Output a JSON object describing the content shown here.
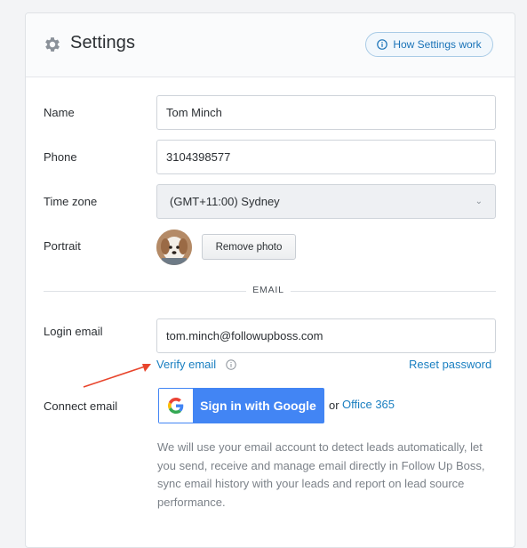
{
  "header": {
    "title": "Settings",
    "help_button_label": "How Settings work",
    "gear_icon": "gear-icon",
    "info_icon": "info-icon"
  },
  "form": {
    "name": {
      "label": "Name",
      "value": "Tom Minch"
    },
    "phone": {
      "label": "Phone",
      "value": "3104398577"
    },
    "timezone": {
      "label": "Time zone",
      "value": "(GMT+11:00) Sydney"
    },
    "portrait": {
      "label": "Portrait",
      "remove_label": "Remove photo"
    }
  },
  "email_section": {
    "divider_label": "EMAIL",
    "login_email": {
      "label": "Login email",
      "value": "tom.minch@followupboss.com"
    },
    "verify_link": "Verify email",
    "reset_link": "Reset password",
    "connect_email": {
      "label": "Connect email",
      "google_button": "Sign in with Google",
      "or_text": "or",
      "office_link": "Office 365"
    },
    "description": "We will use your email account to detect leads automatically, let you send, receive and manage email directly in Follow Up Boss, sync email history with your leads and report on lead source performance."
  },
  "colors": {
    "accent": "#1a7fc1",
    "google_blue": "#4285f4",
    "annotation_arrow": "#e8452c"
  }
}
